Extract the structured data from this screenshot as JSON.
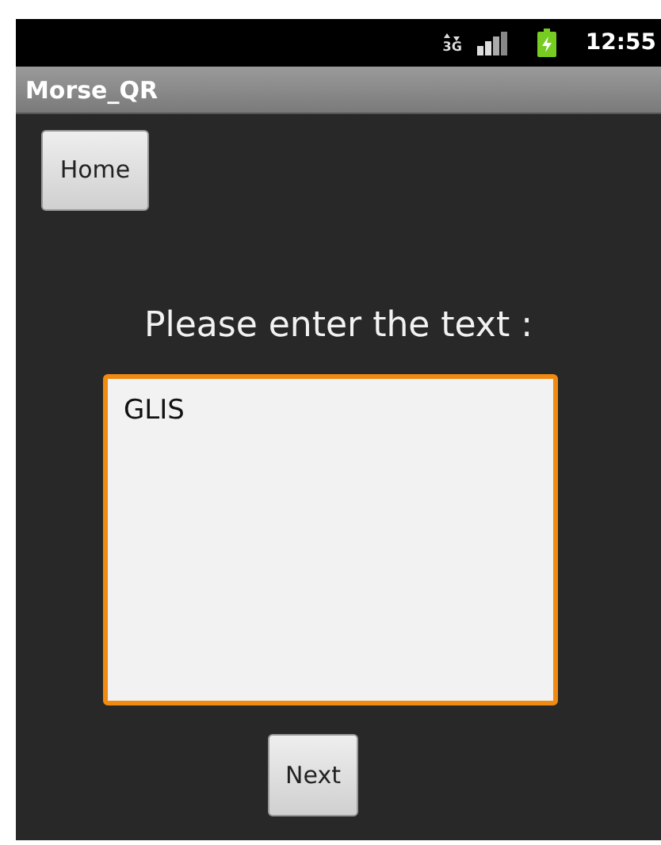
{
  "status_bar": {
    "network_type": "3G",
    "time": "12:55"
  },
  "app_bar": {
    "title": "Morse_QR"
  },
  "home_button": {
    "label": "Home"
  },
  "prompt": "Please enter the text :",
  "text_field": {
    "value": "GLIS",
    "focused": true
  },
  "next_button": {
    "label": "Next"
  }
}
